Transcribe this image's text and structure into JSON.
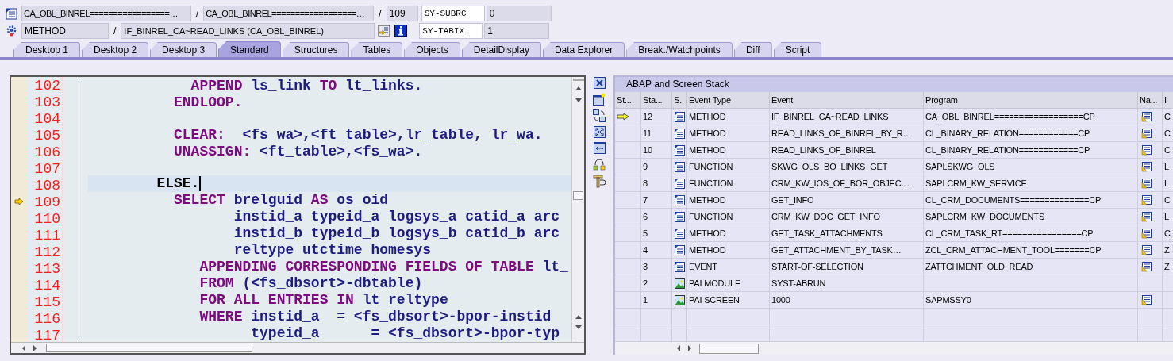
{
  "header": {
    "program": "CA_OBL_BINREL=================…",
    "include": "CA_OBL_BINREL==================…",
    "line": "109",
    "event_type": "METHOD",
    "event": "IF_BINREL_CA~READ_LINKS (CA_OBL_BINREL)",
    "separators": [
      "/",
      "/",
      "/"
    ],
    "sysvars": [
      {
        "name": "SY-SUBRC",
        "value": "0"
      },
      {
        "name": "SY-TABIX",
        "value": "1"
      }
    ]
  },
  "tabs": [
    {
      "label": "Desktop 1",
      "selected": false
    },
    {
      "label": "Desktop 2",
      "selected": false
    },
    {
      "label": "Desktop 3",
      "selected": false
    },
    {
      "label": "Standard",
      "selected": true
    },
    {
      "label": "Structures",
      "selected": false
    },
    {
      "label": "Tables",
      "selected": false
    },
    {
      "label": "Objects",
      "selected": false
    },
    {
      "label": "DetailDisplay",
      "selected": false
    },
    {
      "label": "Data Explorer",
      "selected": false
    },
    {
      "label": "Break./Watchpoints",
      "selected": false
    },
    {
      "label": "Diff",
      "selected": false
    },
    {
      "label": "Script",
      "selected": false
    }
  ],
  "editor": {
    "lines": [
      {
        "number": "102",
        "current": false,
        "cursor": false,
        "segments": [
          {
            "text": "            APPEND",
            "kind": "keyword"
          },
          {
            "text": " ls_link ",
            "kind": "name"
          },
          {
            "text": "TO",
            "kind": "keyword"
          },
          {
            "text": " lt_links.",
            "kind": "name"
          }
        ]
      },
      {
        "number": "103",
        "current": false,
        "cursor": false,
        "segments": [
          {
            "text": "          ENDLOOP.",
            "kind": "keyword"
          }
        ]
      },
      {
        "number": "104",
        "current": false,
        "cursor": false
      },
      {
        "number": "105",
        "current": false,
        "cursor": false,
        "segments": [
          {
            "text": "          CLEAR:",
            "kind": "keyword"
          },
          {
            "text": "  <fs_wa>,<ft_table>,lr_table, lr_wa.",
            "kind": "name"
          }
        ]
      },
      {
        "number": "106",
        "current": false,
        "cursor": false,
        "segments": [
          {
            "text": "          UNASSIGN:",
            "kind": "keyword"
          },
          {
            "text": " <ft_table>,<fs_wa>.",
            "kind": "name"
          }
        ]
      },
      {
        "number": "107",
        "current": false,
        "cursor": false
      },
      {
        "number": "108",
        "current": false,
        "cursor": true,
        "segments": [
          {
            "text": "        ELSE.",
            "kind": "plain"
          }
        ]
      },
      {
        "number": "109",
        "current": true,
        "cursor": false,
        "segments": [
          {
            "text": "          SELECT",
            "kind": "keyword"
          },
          {
            "text": " brelguid ",
            "kind": "name"
          },
          {
            "text": "AS",
            "kind": "keyword"
          },
          {
            "text": " os_oid",
            "kind": "name"
          }
        ]
      },
      {
        "number": "110",
        "current": false,
        "cursor": false,
        "segments": [
          {
            "text": "                 instid_a typeid_a logsys_a catid_a arc",
            "kind": "name"
          }
        ]
      },
      {
        "number": "111",
        "current": false,
        "cursor": false,
        "segments": [
          {
            "text": "                 instid_b typeid_b logsys_b catid_b arc",
            "kind": "name"
          }
        ]
      },
      {
        "number": "112",
        "current": false,
        "cursor": false,
        "segments": [
          {
            "text": "                 reltype utctime homesys",
            "kind": "name"
          }
        ]
      },
      {
        "number": "113",
        "current": false,
        "cursor": false,
        "segments": [
          {
            "text": "             APPENDING CORRESPONDING FIELDS OF TABLE",
            "kind": "keyword"
          },
          {
            "text": " lt_",
            "kind": "name"
          }
        ]
      },
      {
        "number": "114",
        "current": false,
        "cursor": false,
        "segments": [
          {
            "text": "             FROM",
            "kind": "keyword"
          },
          {
            "text": " (<fs_dbsort>-dbtable)",
            "kind": "name"
          }
        ]
      },
      {
        "number": "115",
        "current": false,
        "cursor": false,
        "segments": [
          {
            "text": "             FOR ALL ENTRIES IN",
            "kind": "keyword"
          },
          {
            "text": " lt_reltype",
            "kind": "name"
          }
        ]
      },
      {
        "number": "116",
        "current": false,
        "cursor": false,
        "segments": [
          {
            "text": "             WHERE",
            "kind": "keyword"
          },
          {
            "text": " instid_a  = <fs_dbsort>-bpor-instid",
            "kind": "name"
          }
        ]
      },
      {
        "number": "117",
        "current": false,
        "cursor": false,
        "segments": [
          {
            "text": "                   typeid_a      = <fs_dbsort>-bpor-typ",
            "kind": "name"
          }
        ]
      }
    ]
  },
  "stack": {
    "title": "ABAP and Screen Stack",
    "columns": [
      "St...",
      "Sta...",
      "S..",
      "Event Type",
      "Event",
      "Program",
      "Na...",
      "I"
    ],
    "rows": [
      {
        "stack_top": true,
        "level": "12",
        "kind": "code",
        "event_type": "METHOD",
        "event": "IF_BINREL_CA~READ_LINKS",
        "program": "CA_OBL_BINREL==================CP",
        "navigate": true,
        "column_8": "C"
      },
      {
        "stack_top": false,
        "level": "11",
        "kind": "code",
        "event_type": "METHOD",
        "event": "READ_LINKS_OF_BINREL_BY_R…",
        "program": "CL_BINARY_RELATION============CP",
        "navigate": true,
        "column_8": "C"
      },
      {
        "stack_top": false,
        "level": "10",
        "kind": "code",
        "event_type": "METHOD",
        "event": "READ_LINKS_OF_BINREL",
        "program": "CL_BINARY_RELATION============CP",
        "navigate": true,
        "column_8": "C"
      },
      {
        "stack_top": false,
        "level": "9",
        "kind": "code",
        "event_type": "FUNCTION",
        "event": "SKWG_OLS_BO_LINKS_GET",
        "program": "SAPLSKWG_OLS",
        "navigate": true,
        "column_8": "L"
      },
      {
        "stack_top": false,
        "level": "8",
        "kind": "code",
        "event_type": "FUNCTION",
        "event": "CRM_KW_IOS_OF_BOR_OBJEC…",
        "program": "SAPLCRM_KW_SERVICE",
        "navigate": true,
        "column_8": "L"
      },
      {
        "stack_top": false,
        "level": "7",
        "kind": "code",
        "event_type": "METHOD",
        "event": "GET_INFO",
        "program": "CL_CRM_DOCUMENTS==============CP",
        "navigate": true,
        "column_8": "C"
      },
      {
        "stack_top": false,
        "level": "6",
        "kind": "code",
        "event_type": "FUNCTION",
        "event": "CRM_KW_DOC_GET_INFO",
        "program": "SAPLCRM_KW_DOCUMENTS",
        "navigate": true,
        "column_8": "L"
      },
      {
        "stack_top": false,
        "level": "5",
        "kind": "code",
        "event_type": "METHOD",
        "event": "GET_TASK_ATTACHMENTS",
        "program": "CL_CRM_TASK_RT================CP",
        "navigate": true,
        "column_8": "C"
      },
      {
        "stack_top": false,
        "level": "4",
        "kind": "code",
        "event_type": "METHOD",
        "event": "GET_ATTACHMENT_BY_TASK…",
        "program": "ZCL_CRM_ATTACHMENT_TOOL=======CP",
        "navigate": true,
        "column_8": "Z"
      },
      {
        "stack_top": false,
        "level": "3",
        "kind": "code",
        "event_type": "EVENT",
        "event": "START-OF-SELECTION",
        "program": "ZATTCHMENT_OLD_READ",
        "navigate": true,
        "column_8": "Z"
      },
      {
        "stack_top": false,
        "level": "2",
        "kind": "screen",
        "event_type": "PAI MODULE",
        "event": "SYST-ABRUN",
        "navigate": false
      },
      {
        "stack_top": false,
        "level": "1",
        "kind": "screen",
        "event_type": "PAI SCREEN",
        "event": "1000",
        "program": "SAPMSSY0",
        "navigate": true
      }
    ]
  }
}
